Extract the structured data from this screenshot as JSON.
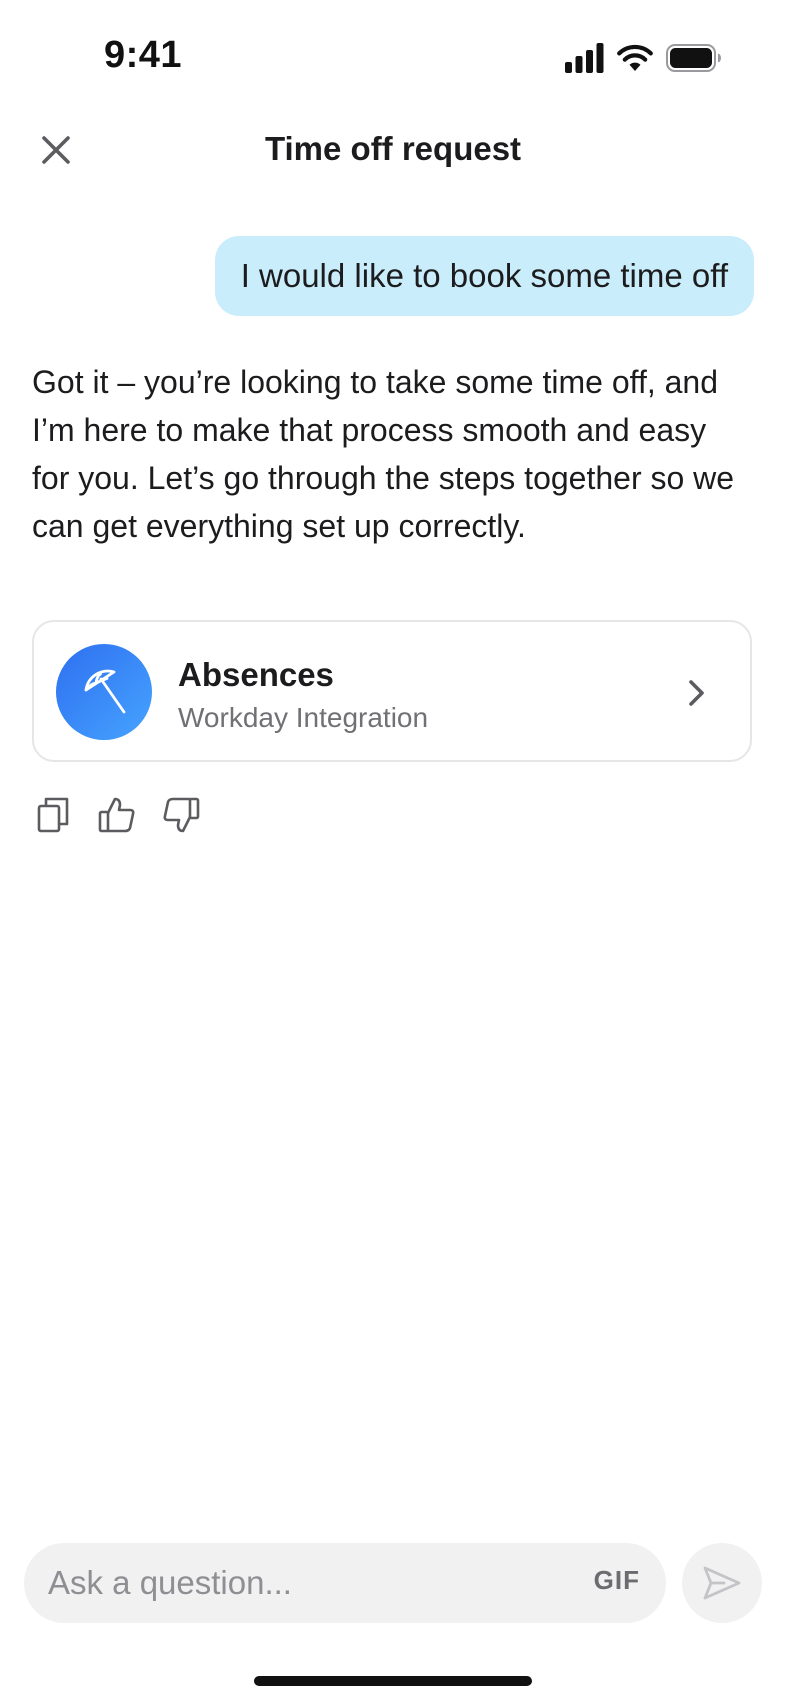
{
  "status_bar": {
    "time": "9:41"
  },
  "header": {
    "title": "Time off request",
    "close_icon": "close-icon"
  },
  "conversation": {
    "user_message": "I would like to book some time off",
    "assistant_message": "Got it – you’re looking to take some time off, and I’m here to make that process smooth and easy for you. Let’s go through the steps together so we can get everything set up correctly.",
    "integration_card": {
      "title": "Absences",
      "subtitle": "Workday Integration",
      "icon": "umbrella-icon"
    },
    "actions": [
      "copy-icon",
      "thumbs-up-icon",
      "thumbs-down-icon"
    ]
  },
  "composer": {
    "placeholder": "Ask a question...",
    "value": "",
    "gif_label": "GIF"
  },
  "colors": {
    "user_bubble": "#c9edfa",
    "avatar_gradient_start": "#2e6ff0",
    "avatar_gradient_end": "#46a4ff",
    "composer_bg": "#f1f1f2"
  }
}
